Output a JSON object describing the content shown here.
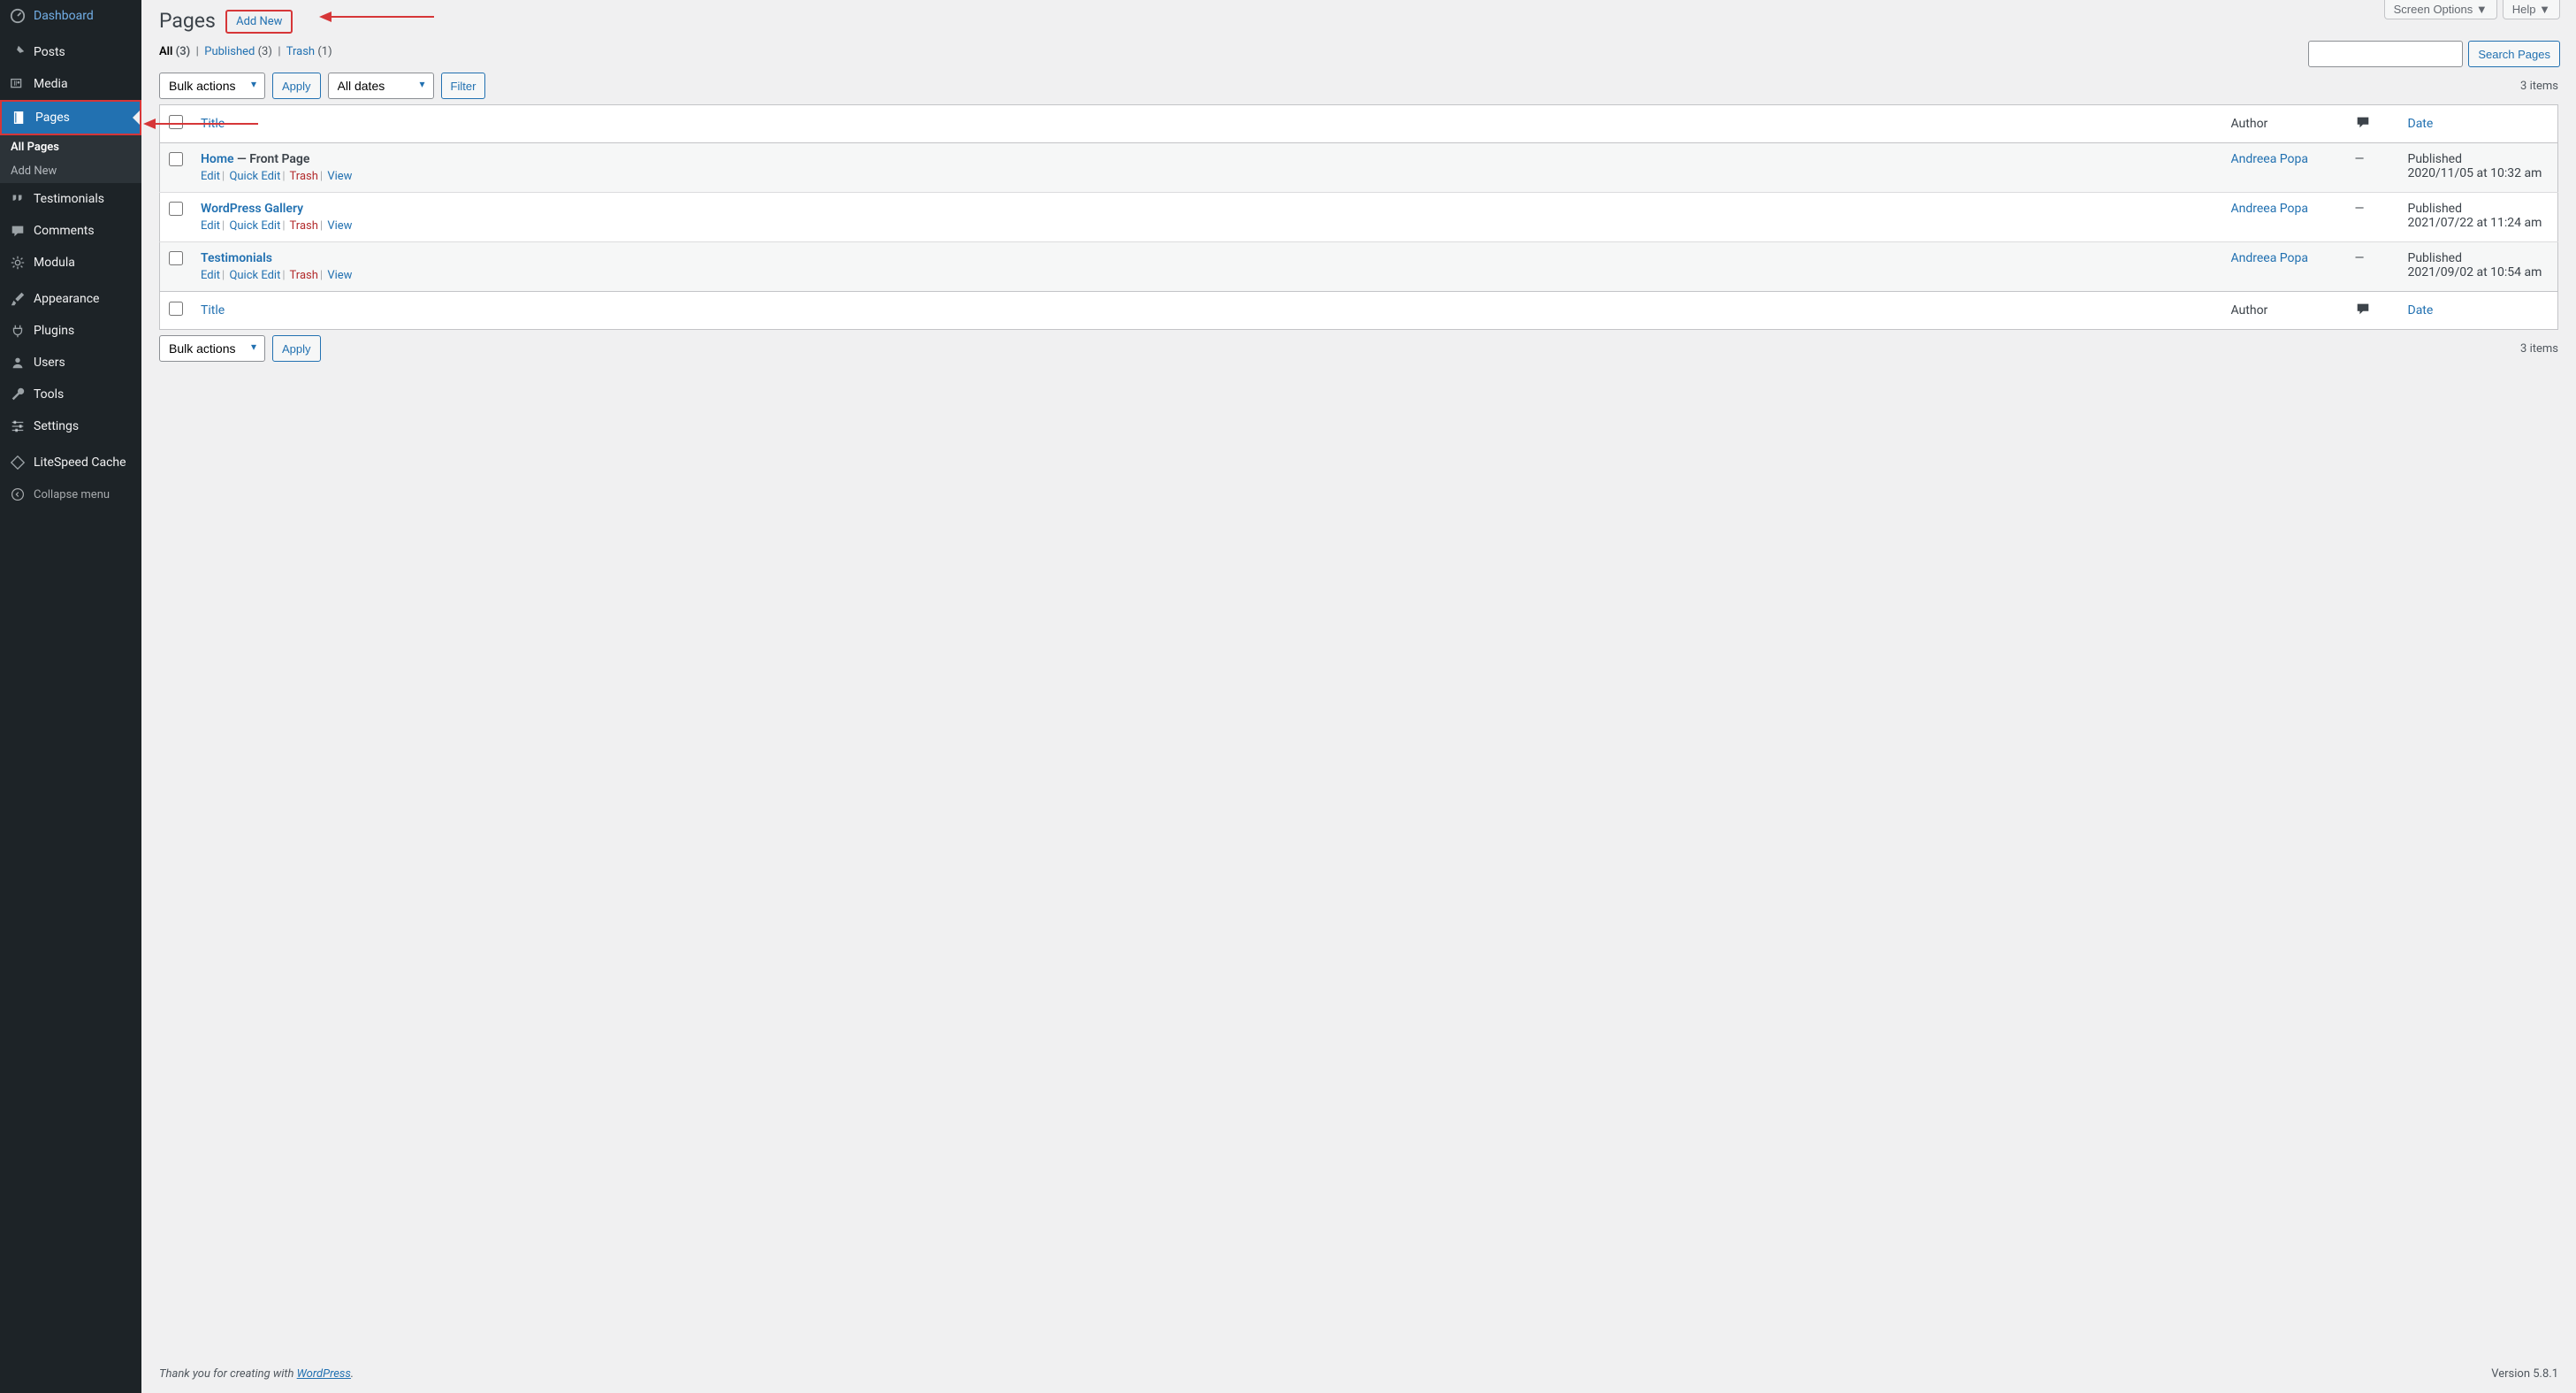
{
  "sidebar": {
    "items": [
      {
        "id": "dashboard",
        "label": "Dashboard"
      },
      {
        "id": "posts",
        "label": "Posts"
      },
      {
        "id": "media",
        "label": "Media"
      },
      {
        "id": "pages",
        "label": "Pages"
      },
      {
        "id": "testimonials",
        "label": "Testimonials"
      },
      {
        "id": "comments",
        "label": "Comments"
      },
      {
        "id": "modula",
        "label": "Modula"
      },
      {
        "id": "appearance",
        "label": "Appearance"
      },
      {
        "id": "plugins",
        "label": "Plugins"
      },
      {
        "id": "users",
        "label": "Users"
      },
      {
        "id": "tools",
        "label": "Tools"
      },
      {
        "id": "settings",
        "label": "Settings"
      },
      {
        "id": "litespeed",
        "label": "LiteSpeed Cache"
      }
    ],
    "pages_sub": {
      "all": "All Pages",
      "add": "Add New"
    },
    "collapse": "Collapse menu"
  },
  "top": {
    "screen_options": "Screen Options",
    "help": "Help"
  },
  "header": {
    "title": "Pages",
    "add_new": "Add New"
  },
  "views": {
    "all_label": "All",
    "all_count": "(3)",
    "published_label": "Published",
    "published_count": "(3)",
    "trash_label": "Trash",
    "trash_count": "(1)"
  },
  "search": {
    "button": "Search Pages",
    "placeholder": ""
  },
  "bulk": {
    "label": "Bulk actions",
    "apply": "Apply"
  },
  "dates": {
    "label": "All dates",
    "filter": "Filter"
  },
  "items_count": "3 items",
  "columns": {
    "title": "Title",
    "author": "Author",
    "date": "Date"
  },
  "row_actions": {
    "edit": "Edit",
    "quick": "Quick Edit",
    "trash": "Trash",
    "view": "View"
  },
  "rows": [
    {
      "title": "Home",
      "state": " — Front Page",
      "author": "Andreea Popa",
      "comments": "—",
      "status": "Published",
      "date": "2020/11/05 at 10:32 am"
    },
    {
      "title": "WordPress Gallery",
      "state": "",
      "author": "Andreea Popa",
      "comments": "—",
      "status": "Published",
      "date": "2021/07/22 at 11:24 am"
    },
    {
      "title": "Testimonials",
      "state": "",
      "author": "Andreea Popa",
      "comments": "—",
      "status": "Published",
      "date": "2021/09/02 at 10:54 am"
    }
  ],
  "footer": {
    "thanks_pre": "Thank you for creating with ",
    "wp": "WordPress",
    "thanks_post": ".",
    "version": "Version 5.8.1"
  }
}
